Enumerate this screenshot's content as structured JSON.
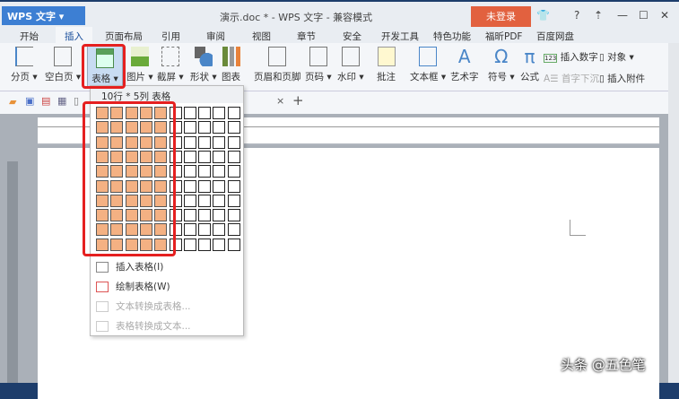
{
  "app": {
    "logo": "WPS 文字",
    "title": "演示.doc * - WPS 文字 - 兼容模式",
    "login": "未登录",
    "help": "?"
  },
  "tabs": [
    "开始",
    "插入",
    "页面布局",
    "引用",
    "审阅",
    "视图",
    "章节",
    "安全",
    "开发工具",
    "特色功能",
    "福昕PDF",
    "百度网盘"
  ],
  "ribbon": {
    "page_break": "分页",
    "blank_page": "空白页",
    "table": "表格",
    "picture": "图片",
    "screenshot": "截屏",
    "shape": "形状",
    "chart": "图表",
    "header_footer": "页眉和页脚",
    "page_number": "页码",
    "watermark": "水印",
    "comment": "批注",
    "textbox": "文本框",
    "wordart": "艺术字",
    "symbol": "符号",
    "formula": "公式",
    "insert_number": "插入数字",
    "object": "对象",
    "dropcap": "首字下沉",
    "attachment": "插入附件"
  },
  "dropdown": {
    "header": "10行 * 5列 表格",
    "rows": 10,
    "cols": 10,
    "selected_rows": 10,
    "selected_cols": 5,
    "items": [
      {
        "label": "插入表格(I)",
        "enabled": true
      },
      {
        "label": "绘制表格(W)",
        "enabled": true
      },
      {
        "label": "文本转换成表格...",
        "enabled": false
      },
      {
        "label": "表格转换成文本...",
        "enabled": false
      }
    ]
  },
  "doc_tab": {
    "close": "×",
    "new": "+"
  },
  "watermark": "头条 @五色笔"
}
